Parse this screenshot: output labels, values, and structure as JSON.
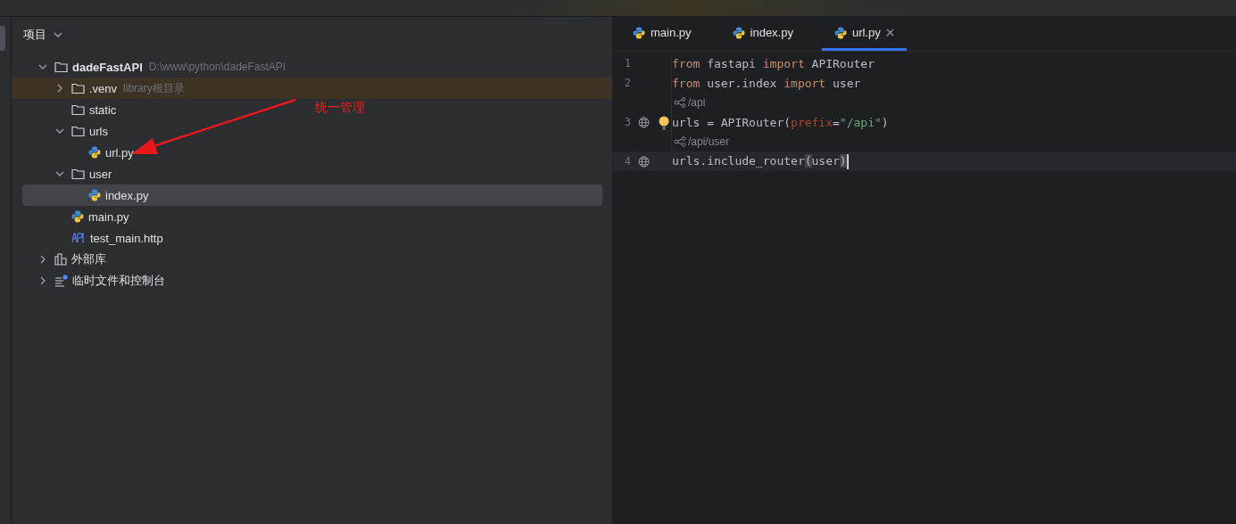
{
  "project_panel": {
    "title": "项目",
    "tree": [
      {
        "kind": "project",
        "name": "dadeFastAPI",
        "hint": "D:\\www\\python\\dadeFastAPI",
        "expanded": true,
        "selected": false,
        "excluded": false,
        "children": [
          {
            "kind": "folder",
            "name": ".venv",
            "hint": "library根目录",
            "expanded": false,
            "selected": false,
            "excluded": true
          },
          {
            "kind": "folder",
            "name": "static",
            "selected": false,
            "excluded": false
          },
          {
            "kind": "folder",
            "name": "urls",
            "expanded": true,
            "selected": false,
            "excluded": false,
            "children": [
              {
                "kind": "python",
                "name": "url.py",
                "selected": false,
                "excluded": false
              }
            ]
          },
          {
            "kind": "folder",
            "name": "user",
            "expanded": true,
            "selected": false,
            "excluded": false,
            "children": [
              {
                "kind": "python",
                "name": "index.py",
                "selected": true,
                "excluded": false
              }
            ]
          },
          {
            "kind": "python",
            "name": "main.py",
            "selected": false,
            "excluded": false
          },
          {
            "kind": "http",
            "name": "test_main.http",
            "selected": false,
            "excluded": false
          }
        ]
      },
      {
        "kind": "library",
        "name": "外部库",
        "expanded": false,
        "selected": false,
        "excluded": false
      },
      {
        "kind": "scratch",
        "name": "临时文件和控制台",
        "expanded": false,
        "selected": false,
        "excluded": false
      }
    ],
    "annotation": "统一管理"
  },
  "editor": {
    "tabs": [
      {
        "label": "main.py",
        "selected": false
      },
      {
        "label": "index.py",
        "selected": false
      },
      {
        "label": "url.py",
        "selected": true
      }
    ],
    "lines": [
      {
        "kind": "code",
        "number": "1",
        "current": false,
        "tokens": [
          {
            "t": "from",
            "kind": "kw"
          },
          {
            "t": " fastapi ",
            "kind": "plain"
          },
          {
            "t": "import",
            "kind": "kw"
          },
          {
            "t": " APIRouter",
            "kind": "plain"
          }
        ]
      },
      {
        "kind": "code",
        "number": "2",
        "current": false,
        "tokens": [
          {
            "t": "from",
            "kind": "kw"
          },
          {
            "t": " user.index ",
            "kind": "plain"
          },
          {
            "t": "import",
            "kind": "kw"
          },
          {
            "t": " user",
            "kind": "plain"
          }
        ]
      },
      {
        "kind": "hint",
        "text": "/api"
      },
      {
        "kind": "code",
        "number": "3",
        "current": false,
        "globe": true,
        "bulb": true,
        "tokens": [
          {
            "t": "urls = APIRouter(",
            "kind": "plain"
          },
          {
            "t": "prefix",
            "kind": "param"
          },
          {
            "t": "=",
            "kind": "plain"
          },
          {
            "t": "\"/api\"",
            "kind": "string"
          },
          {
            "t": ")",
            "kind": "plain"
          }
        ]
      },
      {
        "kind": "hint",
        "text": "/api/user"
      },
      {
        "kind": "code",
        "number": "4",
        "current": true,
        "globe": true,
        "tokens": [
          {
            "t": "urls.include_router",
            "kind": "plain"
          },
          {
            "t": "(",
            "kind": "match"
          },
          {
            "t": "user",
            "kind": "plain"
          },
          {
            "t": ")",
            "kind": "match"
          }
        ]
      }
    ]
  }
}
